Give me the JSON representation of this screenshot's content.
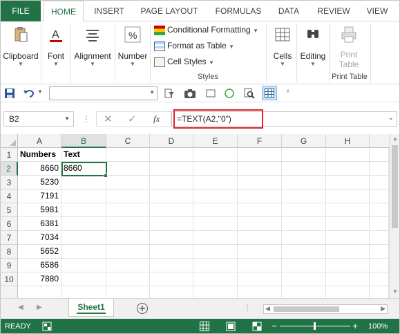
{
  "ribbon_tabs": [
    "FILE",
    "HOME",
    "INSERT",
    "PAGE LAYOUT",
    "FORMULAS",
    "DATA",
    "REVIEW",
    "VIEW"
  ],
  "ribbon": {
    "clipboard": "Clipboard",
    "font": "Font",
    "alignment": "Alignment",
    "number": "Number",
    "conditional_formatting": "Conditional Formatting",
    "format_as_table": "Format as Table",
    "cell_styles": "Cell Styles",
    "styles_group": "Styles",
    "cells": "Cells",
    "editing": "Editing",
    "print_table_line1": "Print",
    "print_table_line2": "Table",
    "print_table_group": "Print Table"
  },
  "formula_bar": {
    "name_box": "B2",
    "formula": "=TEXT(A2,\"0\")"
  },
  "grid": {
    "columns": [
      "A",
      "B",
      "C",
      "D",
      "E",
      "F",
      "G",
      "H"
    ],
    "selected_column": "B",
    "selected_row": "2",
    "rows": [
      {
        "row": "1",
        "a": "Numbers",
        "b": "Text"
      },
      {
        "row": "2",
        "a": "8660",
        "b": "8660"
      },
      {
        "row": "3",
        "a": "5230",
        "b": ""
      },
      {
        "row": "4",
        "a": "7191",
        "b": ""
      },
      {
        "row": "5",
        "a": "5981",
        "b": ""
      },
      {
        "row": "6",
        "a": "6381",
        "b": ""
      },
      {
        "row": "7",
        "a": "7034",
        "b": ""
      },
      {
        "row": "8",
        "a": "5652",
        "b": ""
      },
      {
        "row": "9",
        "a": "6586",
        "b": ""
      },
      {
        "row": "10",
        "a": "7880",
        "b": ""
      }
    ]
  },
  "sheet_tab": "Sheet1",
  "status": {
    "mode": "READY",
    "zoom": "100%"
  },
  "colors": {
    "accent": "#217346",
    "highlight_box": "#e0202a"
  }
}
